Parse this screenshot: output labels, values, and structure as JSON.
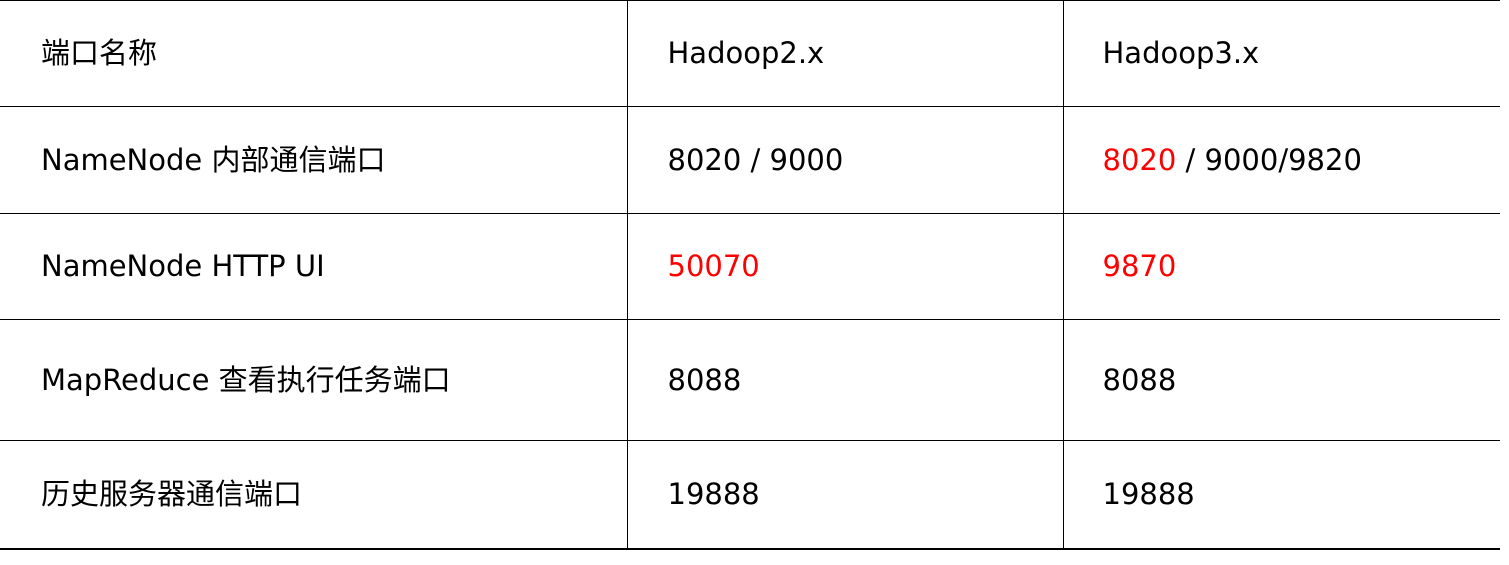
{
  "table": {
    "header": {
      "col1": "端口名称",
      "col2": "Hadoop2.x",
      "col3": "Hadoop3.x"
    },
    "rows": [
      {
        "name": "NameNode 内部通信端口",
        "hadoop2": "8020 / 9000",
        "hadoop3_highlight": "8020",
        "hadoop3_rest": " / 9000/9820"
      },
      {
        "name": "NameNode HTTP UI",
        "hadoop2": "50070",
        "hadoop3": "9870"
      },
      {
        "name": "MapReduce 查看执行任务端口",
        "hadoop2": "8088",
        "hadoop3": "8088"
      },
      {
        "name": "历史服务器通信端口",
        "hadoop2": "19888",
        "hadoop3": "19888"
      }
    ],
    "colors": {
      "text": "#000000",
      "highlight": "#ff0000",
      "border": "#000000"
    }
  }
}
